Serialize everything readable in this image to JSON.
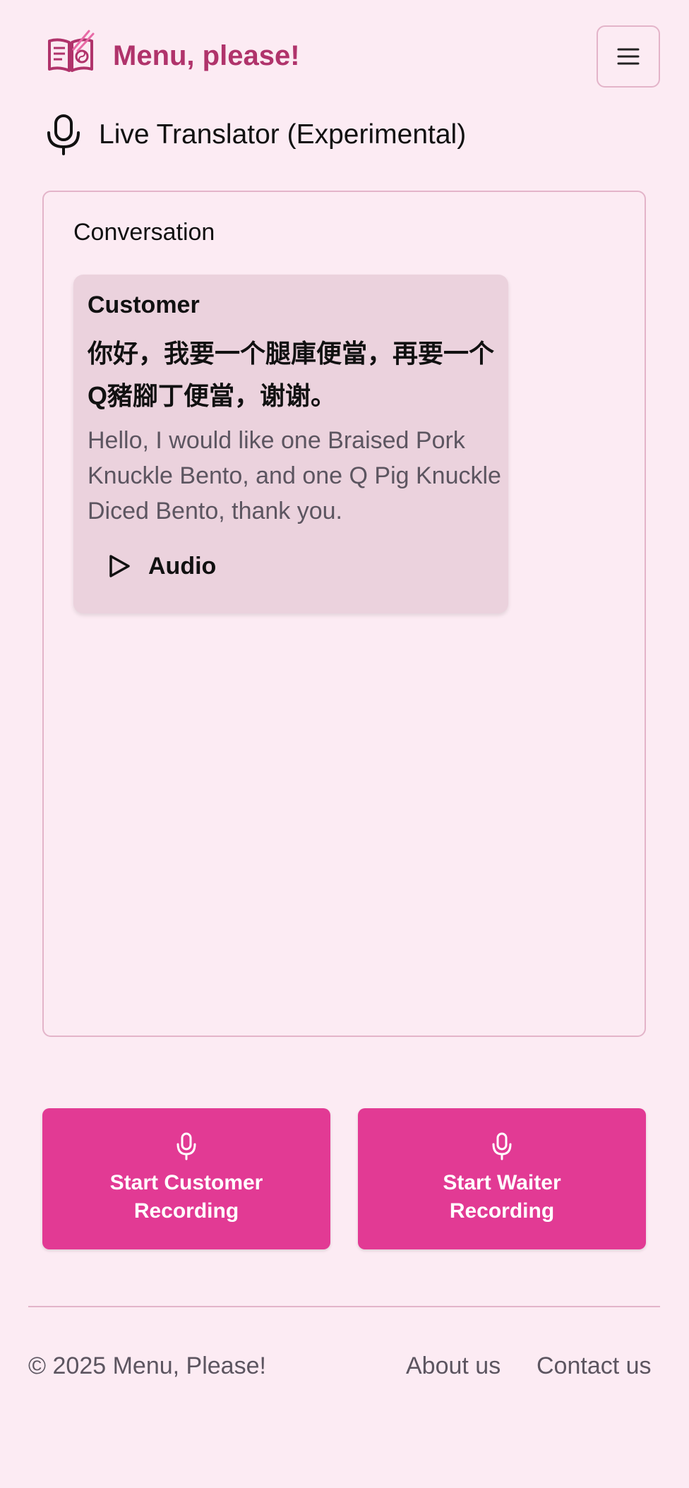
{
  "header": {
    "brand": "Menu, please!",
    "logo_icon": "menu-book-chopsticks-icon",
    "menu_icon": "hamburger-icon"
  },
  "subtitle": {
    "icon": "microphone-icon",
    "text": "Live Translator (Experimental)"
  },
  "conversation": {
    "title": "Conversation",
    "messages": [
      {
        "speaker": "Customer",
        "original": "你好，我要一个腿庫便當，再要一个Q豬腳丁便當，谢谢。",
        "translation": "Hello, I would like one Braised Pork Knuckle Bento, and one Q Pig Knuckle Diced Bento, thank you.",
        "audio_label": "Audio",
        "audio_icon": "play-icon"
      }
    ]
  },
  "actions": {
    "customer_label": "Start Customer Recording",
    "waiter_label": "Start Waiter Recording",
    "icon": "microphone-icon"
  },
  "footer": {
    "copyright": "© 2025 Menu, Please!",
    "about": "About us",
    "contact": "Contact us"
  },
  "colors": {
    "background": "#fcebf3",
    "brand": "#b0336b",
    "accent": "#e23a94",
    "bubble": "#ebd2dd",
    "border": "#e3b4c9"
  }
}
